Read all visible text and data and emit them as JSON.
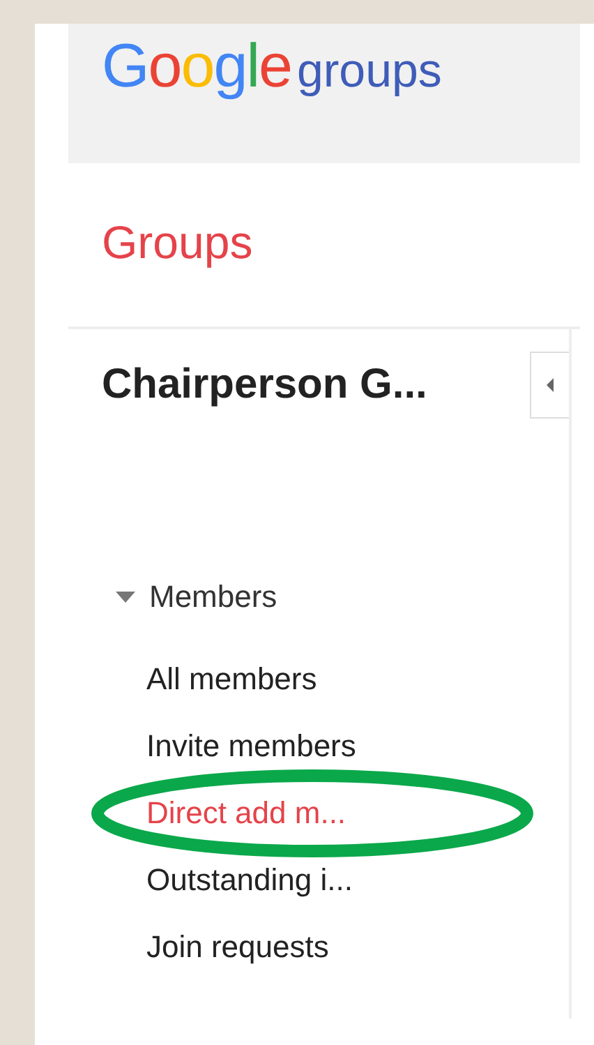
{
  "logo": {
    "brand": "Google",
    "product": "groups"
  },
  "section_title": "Groups",
  "group_name": "Chairperson G...",
  "collapse_button": {
    "expanded": true
  },
  "nav": [
    {
      "label": "Members",
      "expanded": true,
      "children": [
        {
          "label": "All members",
          "selected": false,
          "circled": false
        },
        {
          "label": "Invite members",
          "selected": false,
          "circled": false
        },
        {
          "label": "Direct add m...",
          "selected": true,
          "circled": true
        },
        {
          "label": "Outstanding i...",
          "selected": false,
          "circled": false
        },
        {
          "label": "Join requests",
          "selected": false,
          "circled": false
        }
      ]
    }
  ]
}
